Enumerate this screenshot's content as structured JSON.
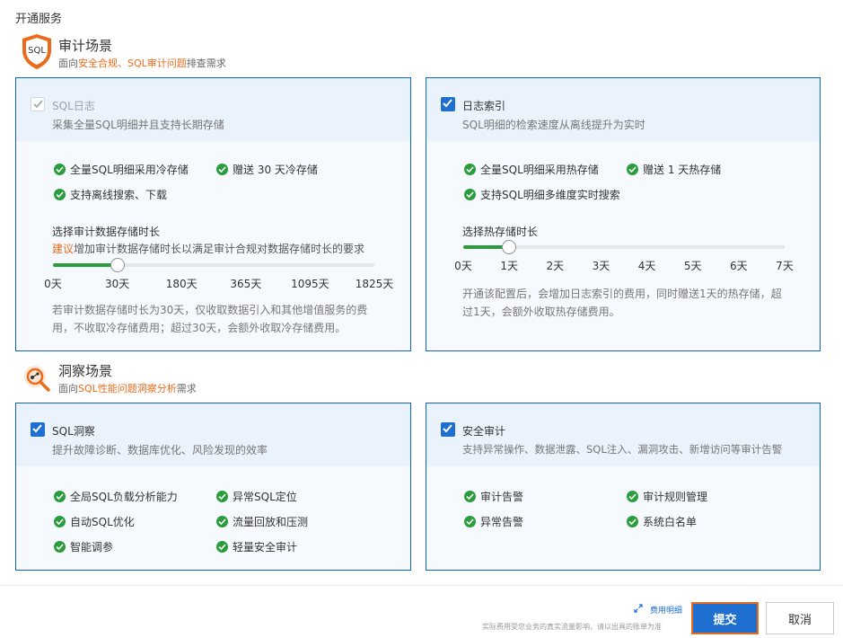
{
  "page": {
    "title": "开通服务"
  },
  "colors": {
    "accent": "#1f6fd1",
    "success": "#2a9d3c",
    "highlight": "#ec6b1a",
    "card_border": "#0b63c4"
  },
  "audit_scene": {
    "icon": "sql-shield-icon",
    "icon_text": "SQL",
    "title": "审计场景",
    "subtitle_prefix": "面向",
    "subtitle_highlight": "安全合规、SQL审计问题",
    "subtitle_suffix": "排查需求",
    "sql_log_card": {
      "checked": true,
      "disabled": true,
      "title": "SQL日志",
      "description": "采集全量SQL明细并且支持长期存储",
      "features": [
        "全量SQL明细采用冷存储",
        "赠送 30 天冷存储",
        "支持离线搜索、下载"
      ],
      "slider_label": "选择审计数据存储时长",
      "advice_prefix": "建议",
      "advice_text": "增加审计数据存储时长以满足审计合规对数据存储时长的要求",
      "ticks": [
        "0天",
        "30天",
        "180天",
        "365天",
        "1095天",
        "1825天"
      ],
      "selected_index": 1,
      "note": [
        "若审计数据存储时长为30天，仅收取数据引入和其他增值服务的费",
        "用，不收取冷存储费用；超过30天，会额外收取冷存储费用。"
      ]
    },
    "log_index_card": {
      "checked": true,
      "title": "日志索引",
      "description": "SQL明细的检索速度从离线提升为实时",
      "features": [
        "全量SQL明细采用热存储",
        "赠送 1 天热存储",
        "支持SQL明细多维度实时搜索"
      ],
      "slider_label": "选择热存储时长",
      "ticks": [
        "0天",
        "1天",
        "2天",
        "3天",
        "4天",
        "5天",
        "6天",
        "7天"
      ],
      "selected_index": 1,
      "note": [
        "开通该配置后，会增加日志索引的费用，同时赠送1天的热存储，超",
        "过1天，会额外收取热存储费用。"
      ]
    }
  },
  "insight_scene": {
    "icon": "insight-magnifier-icon",
    "title": "洞察场景",
    "subtitle_prefix": "面向",
    "subtitle_highlight": "SQL性能问题洞察分析",
    "subtitle_suffix": "需求",
    "sql_insight_card": {
      "checked": true,
      "title": "SQL洞察",
      "description": "提升故障诊断、数据库优化、风险发现的效率",
      "features": [
        "全局SQL负载分析能力",
        "异常SQL定位",
        "自动SQL优化",
        "流量回放和压测",
        "智能调参",
        "轻量安全审计"
      ]
    },
    "security_audit_card": {
      "checked": true,
      "title": "安全审计",
      "description": "支持异常操作、数据泄露、SQL注入、漏洞攻击、新增访问等审计告警",
      "features": [
        "审计告警",
        "审计规则管理",
        "异常告警",
        "系统白名单"
      ]
    }
  },
  "footer": {
    "cost_detail_link": "费用明细",
    "cost_note": "实际费用受您业务的真实流量影响，请以出具的账单为准",
    "submit_label": "提交",
    "cancel_label": "取消"
  }
}
